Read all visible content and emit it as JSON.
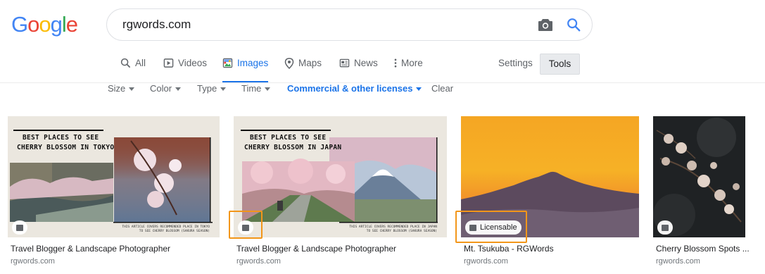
{
  "logo": {
    "letters": [
      "G",
      "o",
      "o",
      "g",
      "l",
      "e"
    ],
    "colors": [
      "#4285f4",
      "#ea4335",
      "#fbbc05",
      "#4285f4",
      "#34a853",
      "#ea4335"
    ]
  },
  "search": {
    "query": "rgwords.com"
  },
  "tabs": [
    {
      "label": "All",
      "icon": "search-icon"
    },
    {
      "label": "Videos",
      "icon": "video-icon"
    },
    {
      "label": "Images",
      "icon": "image-icon",
      "active": true
    },
    {
      "label": "Maps",
      "icon": "map-pin-icon"
    },
    {
      "label": "News",
      "icon": "news-icon"
    },
    {
      "label": "More",
      "icon": "more-vert-icon"
    }
  ],
  "settings_label": "Settings",
  "tools_label": "Tools",
  "filters": [
    {
      "label": "Size"
    },
    {
      "label": "Color"
    },
    {
      "label": "Type"
    },
    {
      "label": "Time"
    },
    {
      "label": "Commercial & other licenses",
      "active": true
    },
    {
      "label": "Clear"
    }
  ],
  "results": [
    {
      "title": "Travel Blogger & Landscape Photographer",
      "site": "rgwords.com",
      "image_heading": [
        "BEST PLACES TO SEE",
        "CHERRY BLOSSOM IN TOKYO"
      ],
      "image_subtext": [
        "THIS ARTICLE COVERS RECOMMENDED PLACE IN TOKYO",
        "TO SEE CHERRY BLOSSOM (SAKURA SEASON)"
      ]
    },
    {
      "title": "Travel Blogger & Landscape Photographer",
      "site": "rgwords.com",
      "image_heading": [
        "BEST PLACES TO SEE",
        "CHERRY BLOSSOM IN JAPAN"
      ],
      "image_subtext": [
        "THIS ARTICLE COVERS RECOMMENDED PLACE IN JAPAN",
        "TO SEE CHERRY BLOSSOM (SAKURA SEASON)"
      ]
    },
    {
      "title": "Mt. Tsukuba - RGWords",
      "site": "rgwords.com",
      "badge": "Licensable"
    },
    {
      "title": "Cherry Blossom Spots ...",
      "site": "rgwords.com"
    }
  ],
  "colors": {
    "accent": "#1a73e8",
    "highlight": "#f2961a"
  }
}
